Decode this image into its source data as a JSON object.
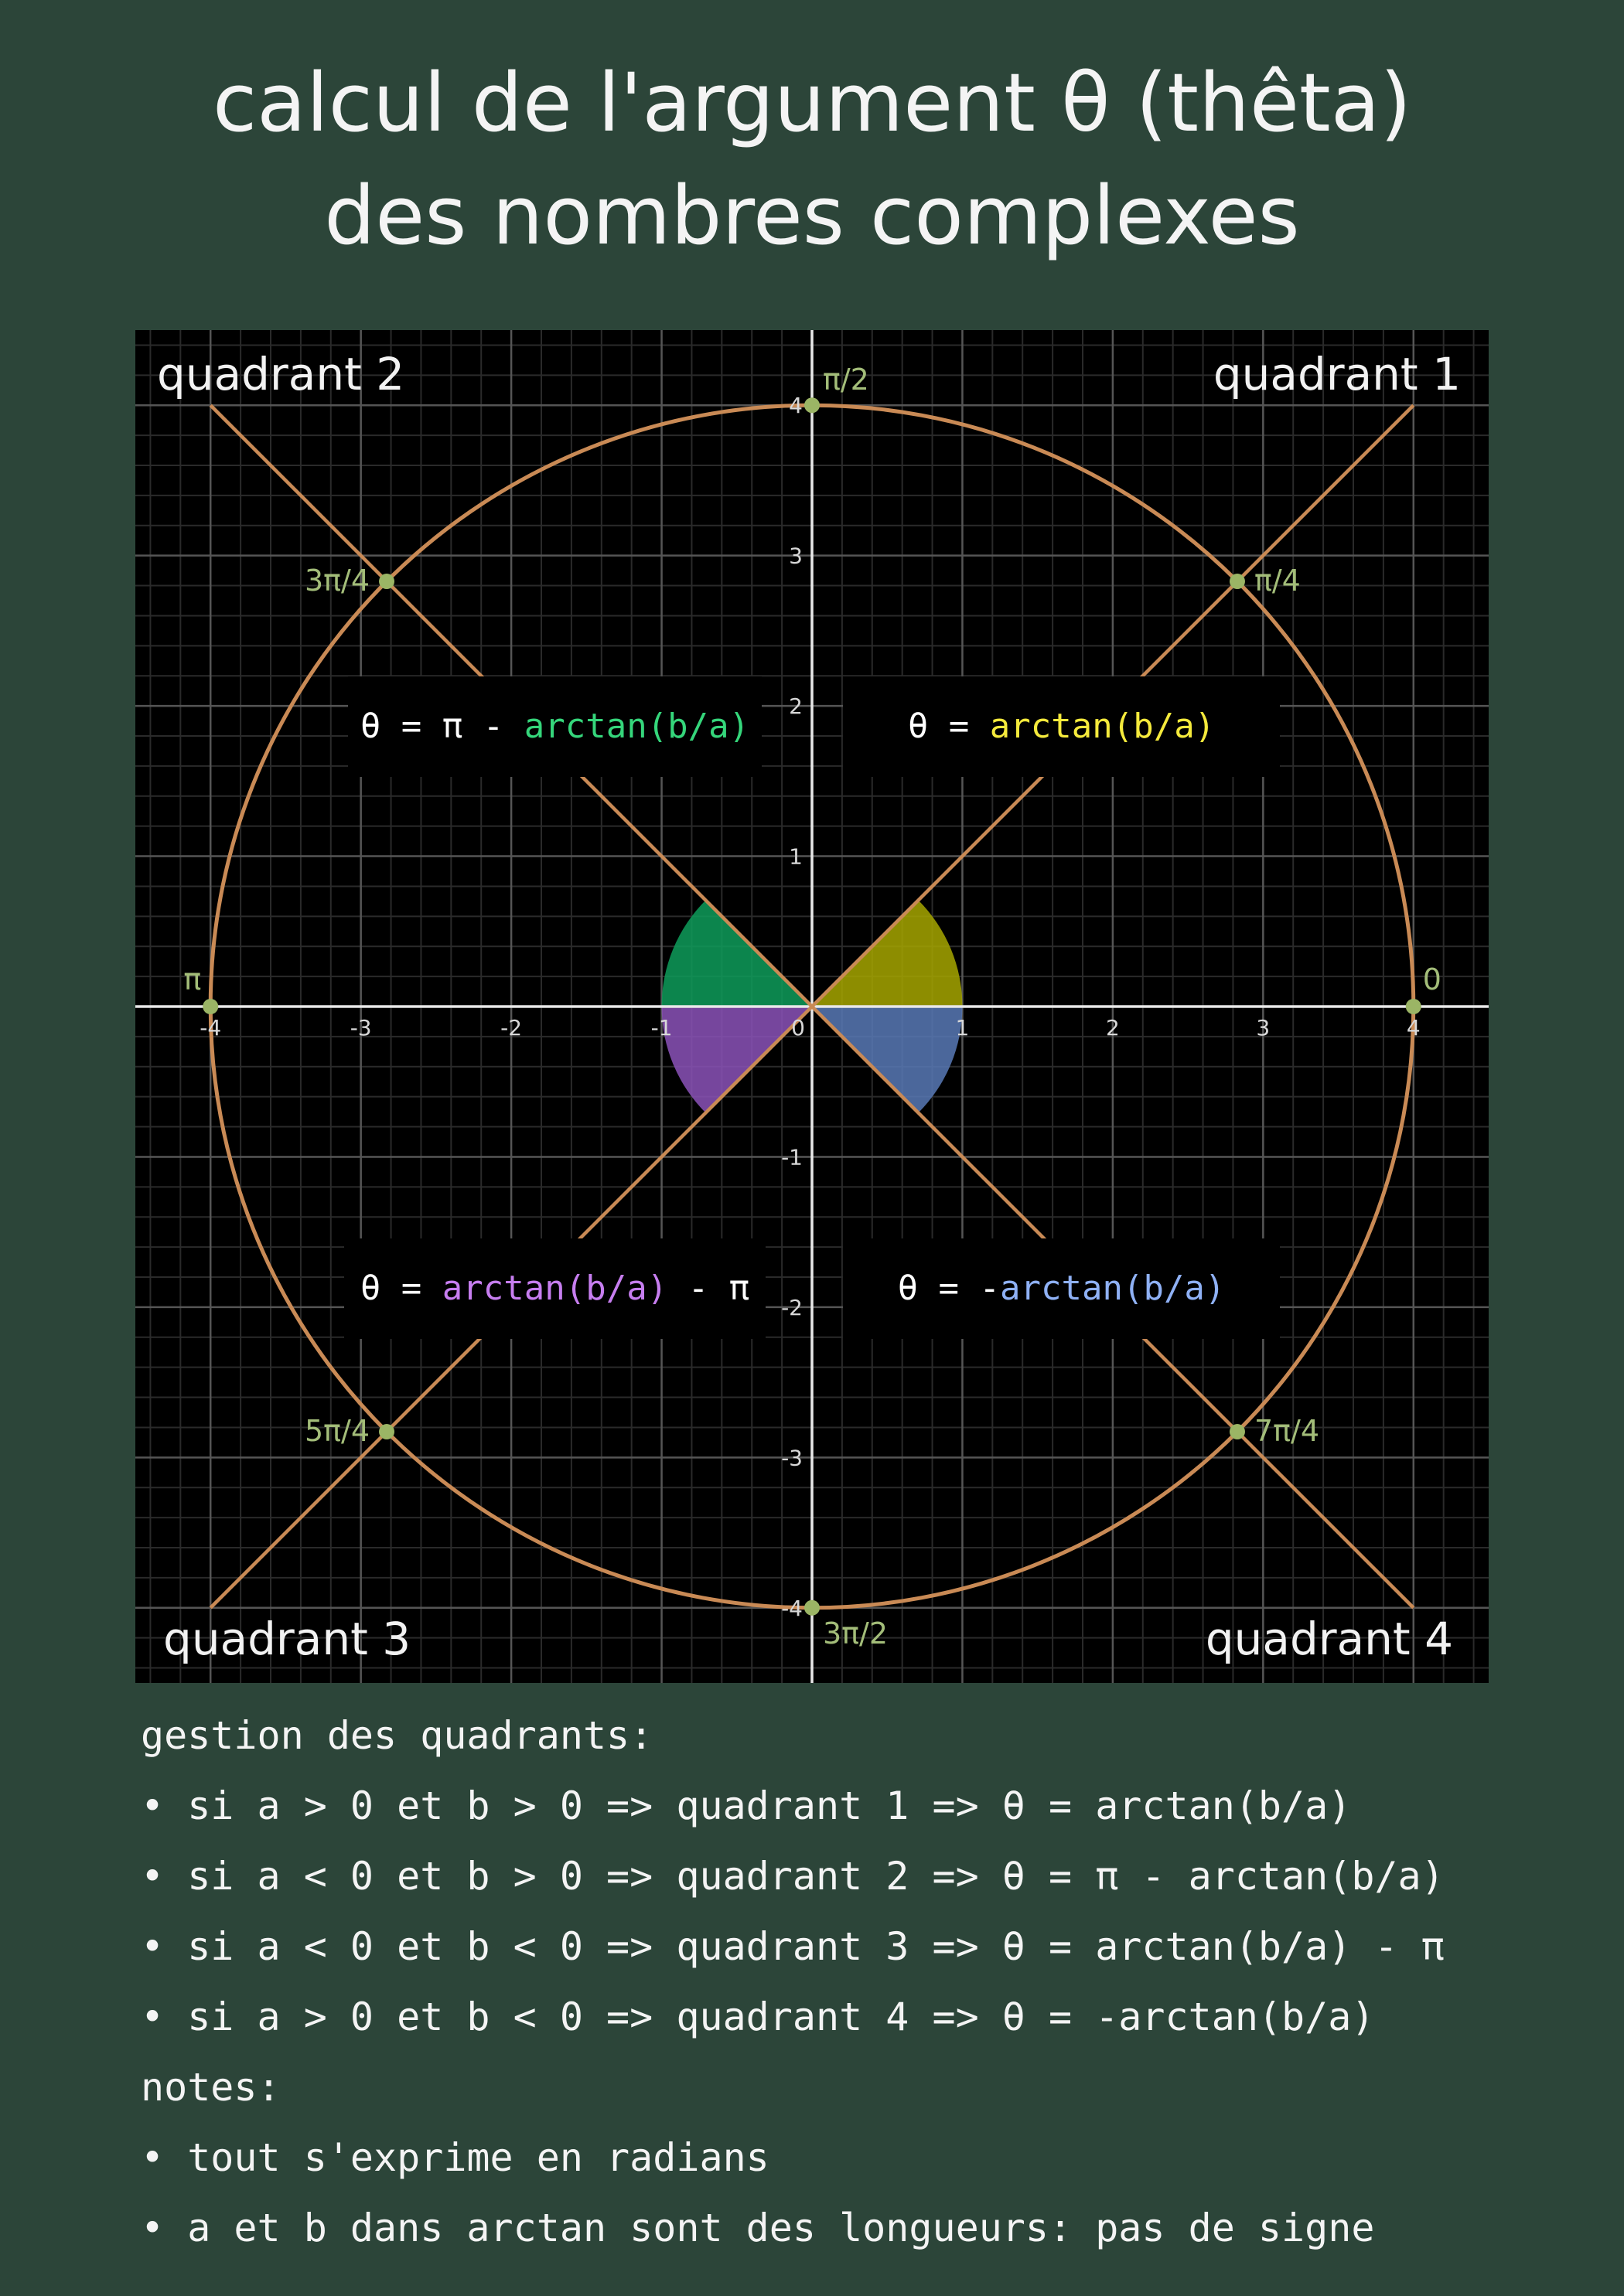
{
  "title": {
    "line1": "calcul de l'argument θ (thêta)",
    "line2": "des nombres complexes"
  },
  "diagram": {
    "quadrants": {
      "q1": "quadrant 1",
      "q2": "quadrant 2",
      "q3": "quadrant 3",
      "q4": "quadrant 4"
    },
    "formulas": {
      "q1": {
        "prefix": "θ = ",
        "highlight": "arctan(b/a)",
        "suffix": ""
      },
      "q2": {
        "prefix": "θ = π - ",
        "highlight": "arctan(b/a)",
        "suffix": ""
      },
      "q3": {
        "prefix": "θ = ",
        "highlight": "arctan(b/a)",
        "suffix": " - π"
      },
      "q4": {
        "prefix": "θ = -",
        "highlight": "arctan(b/a)",
        "suffix": ""
      }
    },
    "angle_labels": [
      {
        "text": "0",
        "angle_deg": 0
      },
      {
        "text": "π/4",
        "angle_deg": 45
      },
      {
        "text": "π/2",
        "angle_deg": 90
      },
      {
        "text": "3π/4",
        "angle_deg": 135
      },
      {
        "text": "π",
        "angle_deg": 180
      },
      {
        "text": "5π/4",
        "angle_deg": 225
      },
      {
        "text": "3π/2",
        "angle_deg": 270
      },
      {
        "text": "7π/4",
        "angle_deg": 315
      }
    ],
    "x_ticks": [
      "-4",
      "-3",
      "-2",
      "-1",
      "0",
      "1",
      "2",
      "3",
      "4"
    ],
    "y_ticks": [
      "4",
      "3",
      "2",
      "1",
      "-1",
      "-2",
      "-3",
      "-4"
    ],
    "axis_range": [
      -4.5,
      4.5
    ],
    "circle_radius": 4,
    "sector_radius": 1,
    "colors": {
      "background": "#2c4539",
      "plot_bg": "#000000",
      "circle": "#c98a55",
      "points": "#9bb565",
      "angle_label": "#a3bd79",
      "q1_fill": "#a6a600",
      "q2_fill": "#0e9c5a",
      "q3_fill": "#8b52b8",
      "q4_fill": "#5879b6"
    }
  },
  "notes": {
    "heading": "gestion des quadrants:",
    "rules": [
      "• si a > 0 et b > 0 => quadrant 1 => θ = arctan(b/a)",
      "• si a < 0 et b > 0 => quadrant 2 => θ = π - arctan(b/a)",
      "• si a < 0 et b < 0 => quadrant 3 => θ = arctan(b/a) - π",
      "• si a > 0 et b < 0 => quadrant 4 => θ = -arctan(b/a)"
    ],
    "notes_heading": "notes:",
    "notes_items": [
      "• tout s'exprime en radians",
      "• a et b dans arctan sont des longueurs: pas de signe"
    ]
  }
}
